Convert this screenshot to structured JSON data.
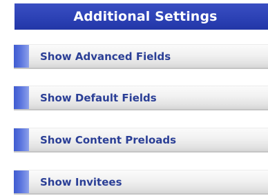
{
  "panel": {
    "title": "Additional Settings",
    "items": [
      {
        "label": "Show Advanced Fields"
      },
      {
        "label": "Show Default Fields"
      },
      {
        "label": "Show Content Preloads"
      },
      {
        "label": "Show Invitees"
      }
    ]
  },
  "colors": {
    "header_bg": "#2b40b4",
    "header_text": "#ffffff",
    "item_text": "#2b3f96",
    "item_accent": "#5a74de",
    "item_bg": "#f1f1f1"
  }
}
